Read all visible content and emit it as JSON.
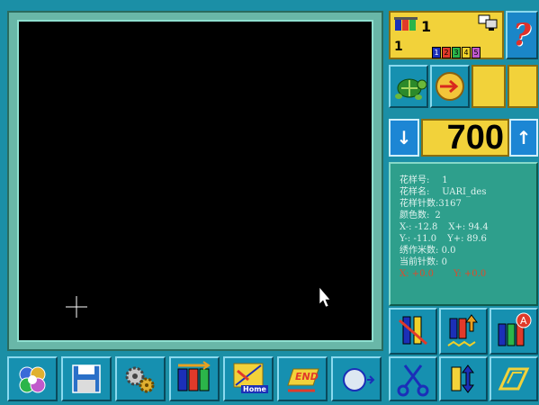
{
  "status": {
    "needle_position": "1",
    "color_number": "1",
    "spools": [
      "1",
      "2",
      "3",
      "4",
      "5"
    ],
    "spool_colors": [
      "#1b2fb8",
      "#e13a2a",
      "#2bb54a",
      "#f0d02a",
      "#c05acb"
    ],
    "help_glyph": "?"
  },
  "speed": {
    "value": "700",
    "down_glyph": "↓",
    "up_glyph": "↑"
  },
  "pattern_info": {
    "pattern_no_label": "花样号:",
    "pattern_no": "1",
    "pattern_name_label": "花样名:",
    "pattern_name": "UARI_des",
    "stitch_count_label": "花样针数:",
    "stitch_count": "3167",
    "color_count_label": "颜色数:",
    "color_count": "2",
    "x_minus_label": "X-:",
    "x_minus": "-12.8",
    "x_plus_label": "X+:",
    "x_plus": "94.4",
    "y_minus_label": "Y-:",
    "y_minus": "-11.0",
    "y_plus_label": "Y+:",
    "y_plus": "89.6",
    "sewn_count_label": "绣作米数:",
    "sewn_count": "0.0",
    "current_stitch_label": "当前针数:",
    "current_stitch": "0",
    "pos_x_label": "X:",
    "pos_x": "+0.0",
    "pos_y_label": "Y:",
    "pos_y": "+0.0"
  },
  "bottom_toolbar": {
    "home_label": "Home",
    "end_label": "END"
  },
  "colors": {
    "background": "#1b8fa6",
    "canvas": "#000000",
    "info_panel": "#2e9f8c",
    "status_yellow": "#f2d23a"
  }
}
